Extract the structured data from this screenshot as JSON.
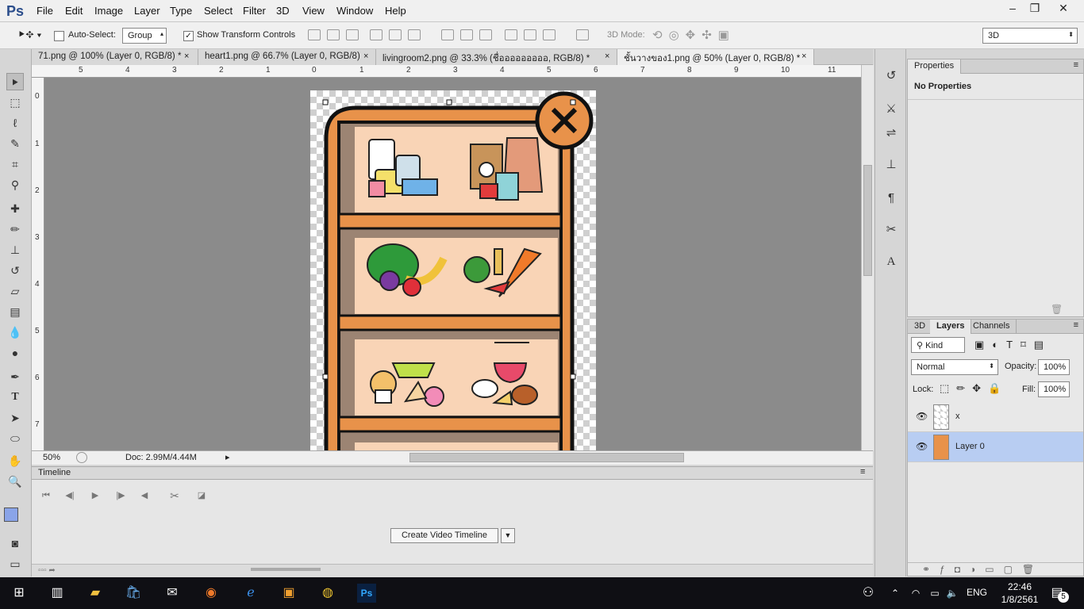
{
  "app": {
    "logo": "Ps",
    "menu": [
      "File",
      "Edit",
      "Image",
      "Layer",
      "Type",
      "Select",
      "Filter",
      "3D",
      "View",
      "Window",
      "Help"
    ]
  },
  "options": {
    "auto_select_label": "Auto-Select:",
    "group_value": "Group",
    "transform_label": "Show Transform Controls",
    "mode_label": "3D Mode:",
    "workspace_value": "3D"
  },
  "tabs": [
    {
      "label": "71.png @ 100% (Layer 0, RGB/8) *"
    },
    {
      "label": "heart1.png @ 66.7% (Layer 0, RGB/8)"
    },
    {
      "label": "livingroom2.png @ 33.3% (ชื่อออออออออ, RGB/8) *"
    },
    {
      "label": "ชั้นวางของ1.png @ 50% (Layer 0, RGB/8) *"
    }
  ],
  "ruler_h": [
    "5",
    "4",
    "3",
    "2",
    "1",
    "0",
    "1",
    "2",
    "3",
    "4",
    "5",
    "6",
    "7",
    "8",
    "9",
    "10",
    "11"
  ],
  "ruler_v": [
    "0",
    "1",
    "2",
    "3",
    "4",
    "5",
    "6",
    "7"
  ],
  "status": {
    "zoom": "50%",
    "doc": "Doc: 2.99M/4.44M"
  },
  "timeline": {
    "title": "Timeline",
    "create_label": "Create Video Timeline"
  },
  "properties": {
    "tab": "Properties",
    "empty_text": "No Properties"
  },
  "layers_panel": {
    "tabs": [
      "3D",
      "Layers",
      "Channels"
    ],
    "kind": "Kind",
    "blend": "Normal",
    "opacity_label": "Opacity:",
    "opacity": "100%",
    "lock_label": "Lock:",
    "fill_label": "Fill:",
    "fill": "100%",
    "layers": [
      {
        "name": "x"
      },
      {
        "name": "Layer 0"
      }
    ]
  },
  "taskbar": {
    "lang": "ENG",
    "time": "22:46",
    "date": "1/8/2561",
    "notif_count": "5"
  },
  "colors": {
    "shelf_frame": "#e8924a",
    "shelf_back": "#f9d4b6",
    "shelf_shadow": "#9c8473",
    "selected_layer": "#b8cdf2"
  }
}
